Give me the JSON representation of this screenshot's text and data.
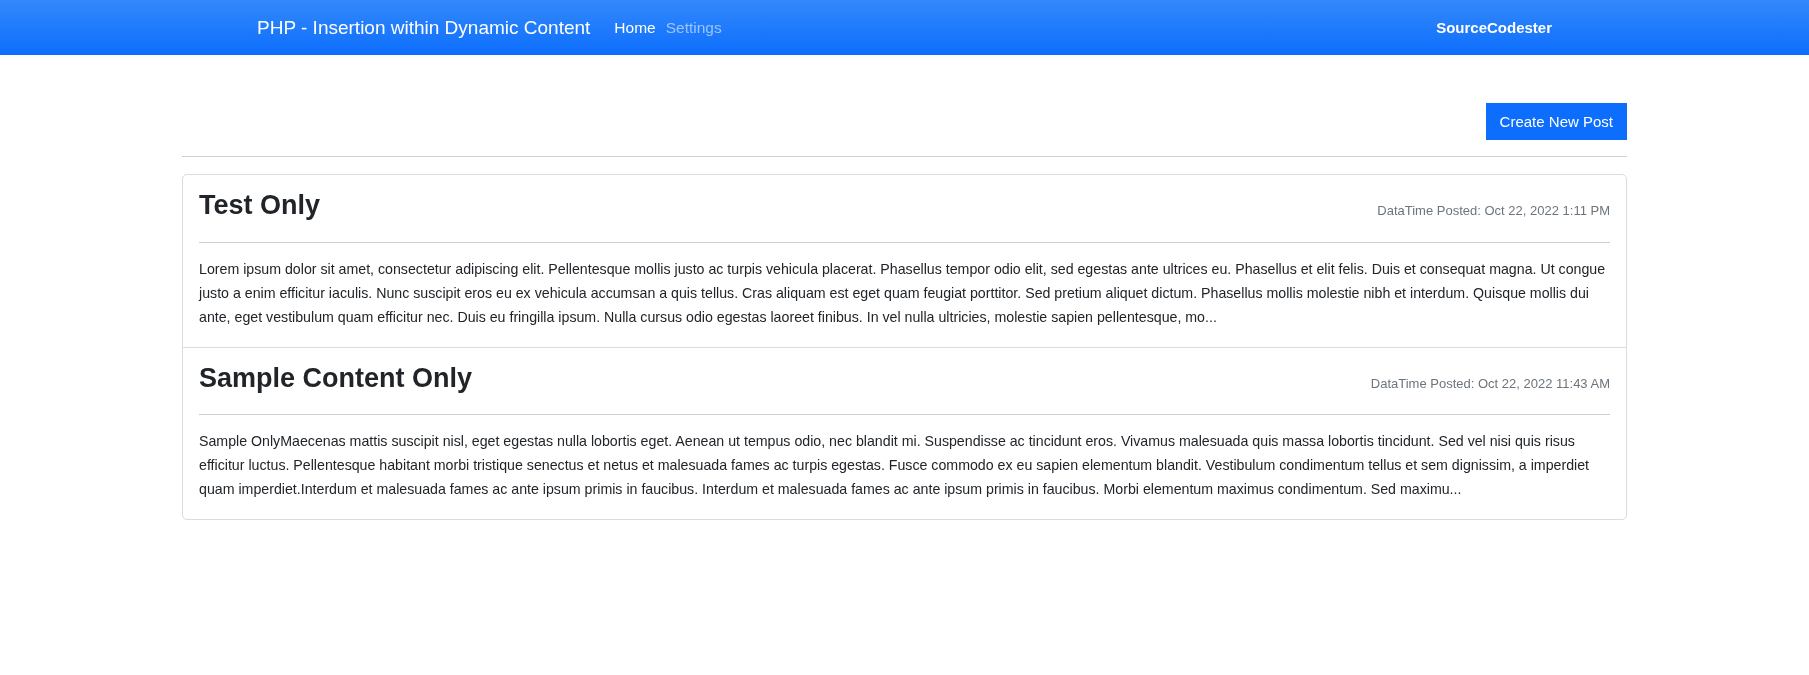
{
  "navbar": {
    "brand": "PHP - Insertion within Dynamic Content",
    "links": [
      {
        "label": "Home",
        "selected": true
      },
      {
        "label": "Settings",
        "selected": false
      }
    ],
    "right_text": "SourceCodester"
  },
  "create_button": "Create New Post",
  "posts": [
    {
      "title": "Test Only",
      "posted": "DataTime Posted: Oct 22, 2022 1:11 PM",
      "body": "Lorem ipsum dolor sit amet, consectetur adipiscing elit. Pellentesque mollis justo ac turpis vehicula placerat. Phasellus tempor odio elit, sed egestas ante ultrices eu. Phasellus et elit felis. Duis et consequat magna. Ut congue justo a enim efficitur iaculis. Nunc suscipit eros eu ex vehicula accumsan a quis tellus. Cras aliquam est eget quam feugiat porttitor. Sed pretium aliquet dictum. Phasellus mollis molestie nibh et interdum. Quisque mollis dui ante, eget vestibulum quam efficitur nec. Duis eu fringilla ipsum. Nulla cursus odio egestas laoreet finibus. In vel nulla ultricies, molestie sapien pellentesque, mo..."
    },
    {
      "title": "Sample Content Only",
      "posted": "DataTime Posted: Oct 22, 2022 11:43 AM",
      "body": "Sample OnlyMaecenas mattis suscipit nisl, eget egestas nulla lobortis eget. Aenean ut tempus odio, nec blandit mi. Suspendisse ac tincidunt eros. Vivamus malesuada quis massa lobortis tincidunt. Sed vel nisi quis risus efficitur luctus. Pellentesque habitant morbi tristique senectus et netus et malesuada fames ac turpis egestas. Fusce commodo ex eu sapien elementum blandit. Vestibulum condimentum tellus et sem dignissim, a imperdiet quam imperdiet.Interdum et malesuada fames ac ante ipsum primis in faucibus. Interdum et malesuada fames ac ante ipsum primis in faucibus. Morbi elementum maximus condimentum. Sed maximu..."
    }
  ]
}
